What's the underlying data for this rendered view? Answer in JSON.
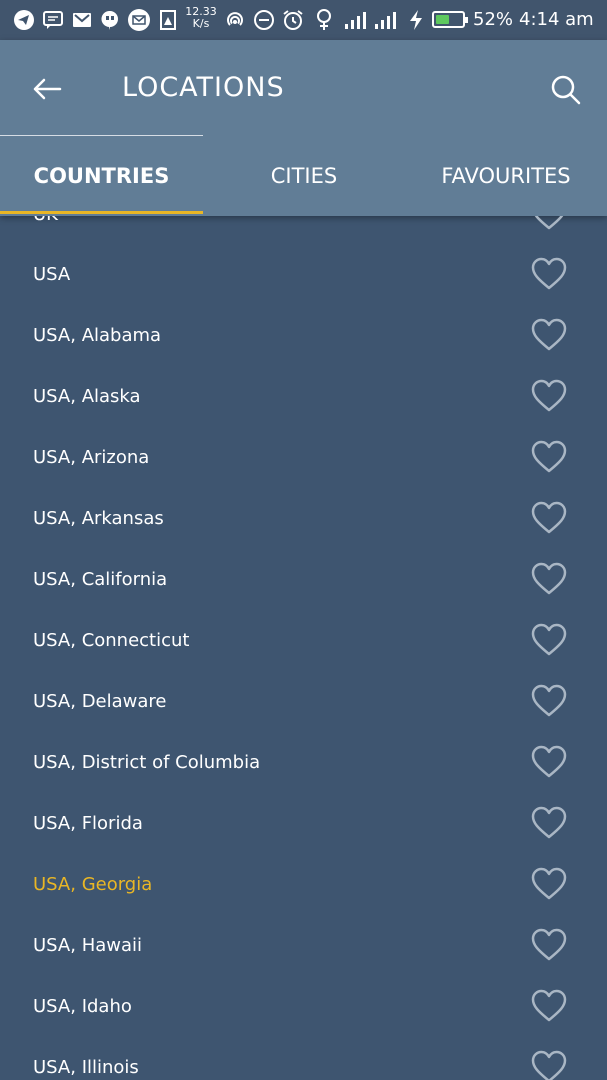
{
  "status_bar": {
    "net_speed_value": "12.33",
    "net_speed_unit": "K/s",
    "battery_percent_label": "52%",
    "battery_level": 0.52,
    "time": "4:14 am",
    "icons": [
      "telegram-icon",
      "message-icon",
      "gmail-icon",
      "hangouts-icon",
      "mail-icon",
      "image-icon",
      "hotspot-icon",
      "dnd-icon",
      "alarm-icon",
      "female-icon",
      "signal-icon",
      "signal-icon",
      "charging-icon",
      "battery-icon"
    ]
  },
  "header": {
    "title": "LOCATIONS"
  },
  "tabs": [
    {
      "label": "COUNTRIES",
      "active": true
    },
    {
      "label": "CITIES",
      "active": false
    },
    {
      "label": "FAVOURITES",
      "active": false
    }
  ],
  "list": {
    "partial_top_label": "UK",
    "items": [
      {
        "label": "USA",
        "selected": false
      },
      {
        "label": "USA, Alabama",
        "selected": false
      },
      {
        "label": "USA, Alaska",
        "selected": false
      },
      {
        "label": "USA, Arizona",
        "selected": false
      },
      {
        "label": "USA, Arkansas",
        "selected": false
      },
      {
        "label": "USA, California",
        "selected": false
      },
      {
        "label": "USA, Connecticut",
        "selected": false
      },
      {
        "label": "USA, Delaware",
        "selected": false
      },
      {
        "label": "USA, District of Columbia",
        "selected": false
      },
      {
        "label": "USA, Florida",
        "selected": false
      },
      {
        "label": "USA, Georgia",
        "selected": true
      },
      {
        "label": "USA, Hawaii",
        "selected": false
      },
      {
        "label": "USA, Idaho",
        "selected": false
      },
      {
        "label": "USA, Illinois",
        "selected": false
      }
    ]
  },
  "colors": {
    "accent": "#e9b625",
    "app_bar": "#617d96",
    "list_background": "#3e5570",
    "status_bar": "#41556d",
    "heart_outline": "#a9b6c4"
  }
}
